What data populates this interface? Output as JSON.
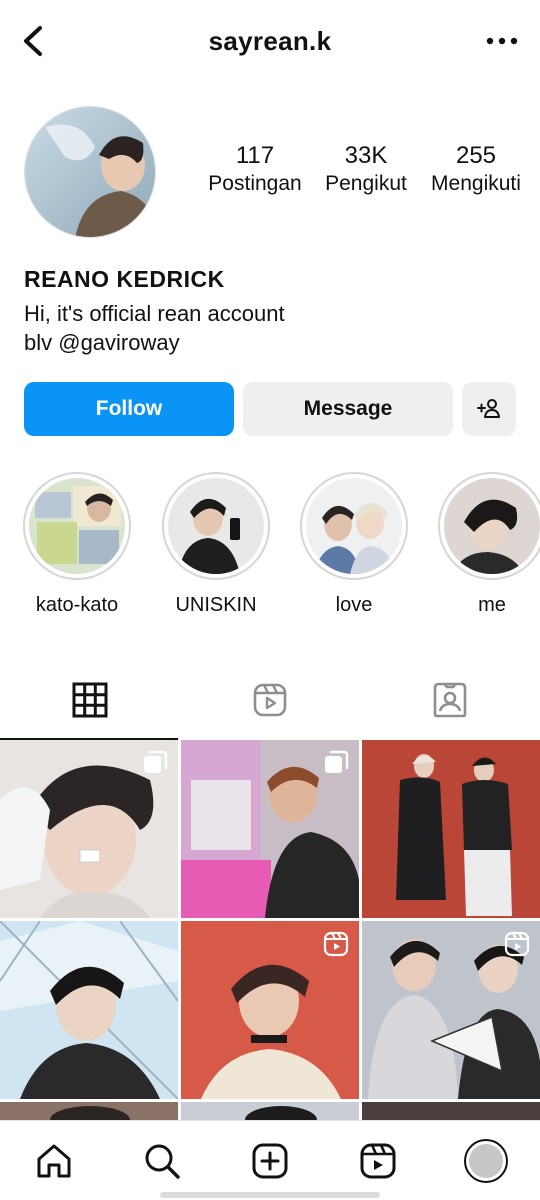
{
  "header": {
    "username": "sayrean.k",
    "back_icon": "chevron-left-icon",
    "more_icon": "more-horizontal-icon"
  },
  "stats": {
    "posts_count": "117",
    "posts_label": "Postingan",
    "followers_count": "33K",
    "followers_label": "Pengikut",
    "following_count": "255",
    "following_label": "Mengikuti"
  },
  "bio": {
    "name": "REANO KEDRICK",
    "line1": "Hi, it's official rean account",
    "line2": "blv @gaviroway"
  },
  "actions": {
    "follow_label": "Follow",
    "message_label": "Message",
    "suggest_icon": "add-person-icon"
  },
  "highlights": [
    {
      "label": "kato-kato"
    },
    {
      "label": "UNISKIN"
    },
    {
      "label": "love"
    },
    {
      "label": "me"
    }
  ],
  "tabs": [
    {
      "icon": "grid-icon",
      "active": true
    },
    {
      "icon": "reels-icon",
      "active": false
    },
    {
      "icon": "tagged-icon",
      "active": false
    }
  ],
  "grid": [
    {
      "badge": "multiple-icon"
    },
    {
      "badge": "multiple-icon"
    },
    {
      "badge": ""
    },
    {
      "badge": ""
    },
    {
      "badge": "reels-icon"
    },
    {
      "badge": "reels-icon"
    }
  ],
  "nav": [
    "home-icon",
    "search-icon",
    "create-icon",
    "reels-icon",
    "profile-avatar"
  ],
  "colors": {
    "accent": "#0a95f6",
    "secondary_button": "#efefef"
  }
}
